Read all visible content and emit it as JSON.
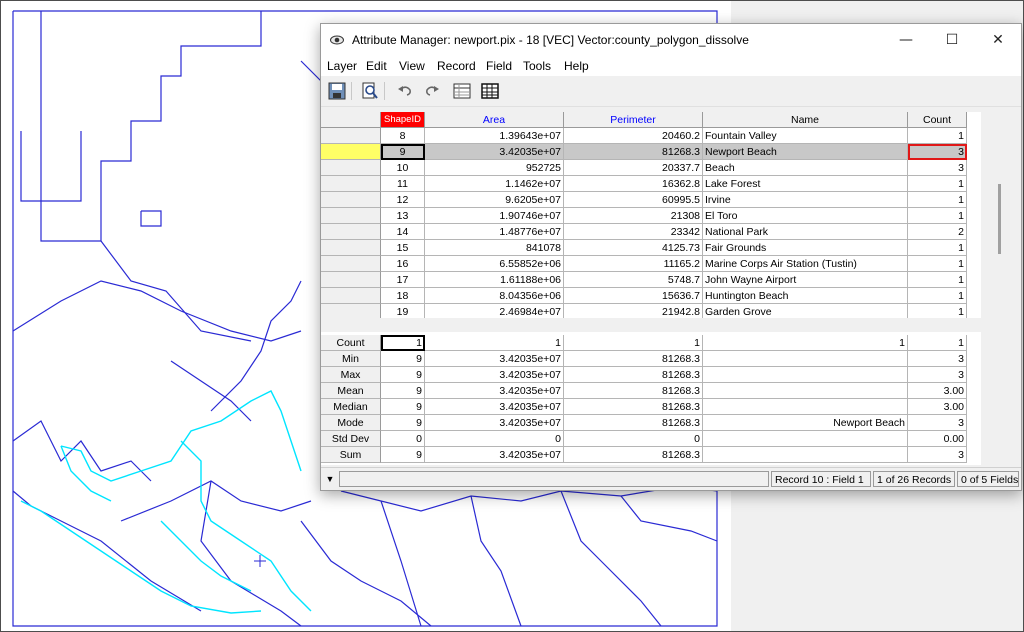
{
  "window": {
    "title": "Attribute Manager: newport.pix - 18 [VEC] Vector:county_polygon_dissolve",
    "minimize": "—",
    "maximize": "☐",
    "close": "✕"
  },
  "menus": [
    "Layer",
    "Edit",
    "View",
    "Record",
    "Field",
    "Tools",
    "Help"
  ],
  "toolbar": {
    "buttons": [
      "save-icon",
      "search-doc-icon",
      "undo-icon",
      "redo-icon",
      "table-icon",
      "grid-icon"
    ]
  },
  "table": {
    "headers": [
      "ShapeID",
      "Area",
      "Perimeter",
      "Name",
      "Count"
    ],
    "header_colors": [
      "#ff0000",
      "#0000ff",
      "#0000ff",
      "#000000",
      "#000000"
    ],
    "selected_row_index": 1,
    "rows": [
      [
        "8",
        "1.39643e+07",
        "20460.2",
        "Fountain Valley",
        "1"
      ],
      [
        "9",
        "3.42035e+07",
        "81268.3",
        "Newport Beach",
        "3"
      ],
      [
        "10",
        "952725",
        "20337.7",
        "Beach",
        "3"
      ],
      [
        "11",
        "1.1462e+07",
        "16362.8",
        "Lake Forest",
        "1"
      ],
      [
        "12",
        "9.6205e+07",
        "60995.5",
        "Irvine",
        "1"
      ],
      [
        "13",
        "1.90746e+07",
        "21308",
        "El Toro",
        "1"
      ],
      [
        "14",
        "1.48776e+07",
        "23342",
        "National Park",
        "2"
      ],
      [
        "15",
        "841078",
        "4125.73",
        "Fair Grounds",
        "1"
      ],
      [
        "16",
        "6.55852e+06",
        "11165.2",
        "Marine Corps Air Station (Tustin)",
        "1"
      ],
      [
        "17",
        "1.61188e+06",
        "5748.7",
        "John Wayne Airport",
        "1"
      ],
      [
        "18",
        "8.04356e+06",
        "15636.7",
        "Huntington Beach",
        "1"
      ],
      [
        "19",
        "2.46984e+07",
        "21942.8",
        "Garden Grove",
        "1"
      ]
    ]
  },
  "stats": [
    {
      "label": "Count",
      "values": [
        "1",
        "1",
        "1",
        "1",
        "1"
      ]
    },
    {
      "label": "Min",
      "values": [
        "9",
        "3.42035e+07",
        "81268.3",
        "",
        "3"
      ]
    },
    {
      "label": "Max",
      "values": [
        "9",
        "3.42035e+07",
        "81268.3",
        "",
        "3"
      ]
    },
    {
      "label": "Mean",
      "values": [
        "9",
        "3.42035e+07",
        "81268.3",
        "",
        "3.00"
      ]
    },
    {
      "label": "Median",
      "values": [
        "9",
        "3.42035e+07",
        "81268.3",
        "",
        "3.00"
      ]
    },
    {
      "label": "Mode",
      "values": [
        "9",
        "3.42035e+07",
        "81268.3",
        "Newport Beach",
        "3"
      ]
    },
    {
      "label": "Std Dev",
      "values": [
        "0",
        "0",
        "0",
        "",
        "0.00"
      ]
    },
    {
      "label": "Sum",
      "values": [
        "9",
        "3.42035e+07",
        "81268.3",
        "",
        "3"
      ]
    }
  ],
  "status": {
    "dropdown_icon": "▼",
    "record_field": "Record 10 : Field 1",
    "records": "1 of 26 Records",
    "fields": "0 of 5 Fields"
  },
  "colors": {
    "map_boundary": "#2a2ad4",
    "map_highlight": "#00e5ff",
    "selected_row_marker": "#ffff66",
    "highlight_box": "#e01818"
  }
}
